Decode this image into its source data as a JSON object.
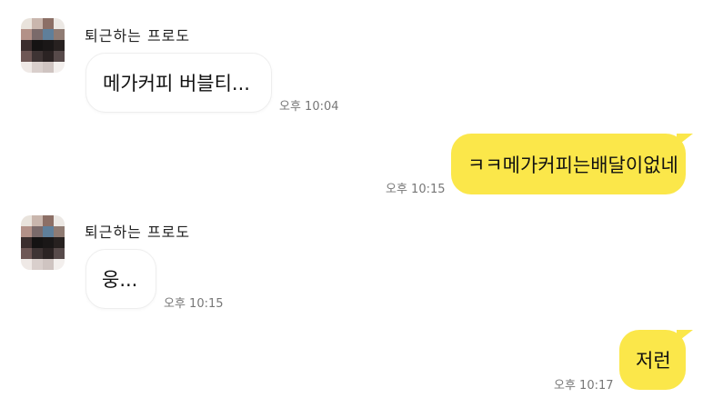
{
  "colors": {
    "outgoing_bubble": "#fbe74a",
    "incoming_bubble": "#ffffff",
    "background": "#ffffff",
    "timestamp": "#777777"
  },
  "messages": [
    {
      "direction": "incoming",
      "sender": "퇴근하는 프로도",
      "text": "메가커피 버블티...",
      "time": "오후 10:04"
    },
    {
      "direction": "outgoing",
      "text": "ㅋㅋ메가커피는배달이없네",
      "time": "오후 10:15"
    },
    {
      "direction": "incoming",
      "sender": "퇴근하는 프로도",
      "text": "웅...",
      "time": "오후 10:15"
    },
    {
      "direction": "outgoing",
      "text": "저런",
      "time": "오후 10:17"
    }
  ],
  "avatar_icon": "pixelated-profile-photo"
}
